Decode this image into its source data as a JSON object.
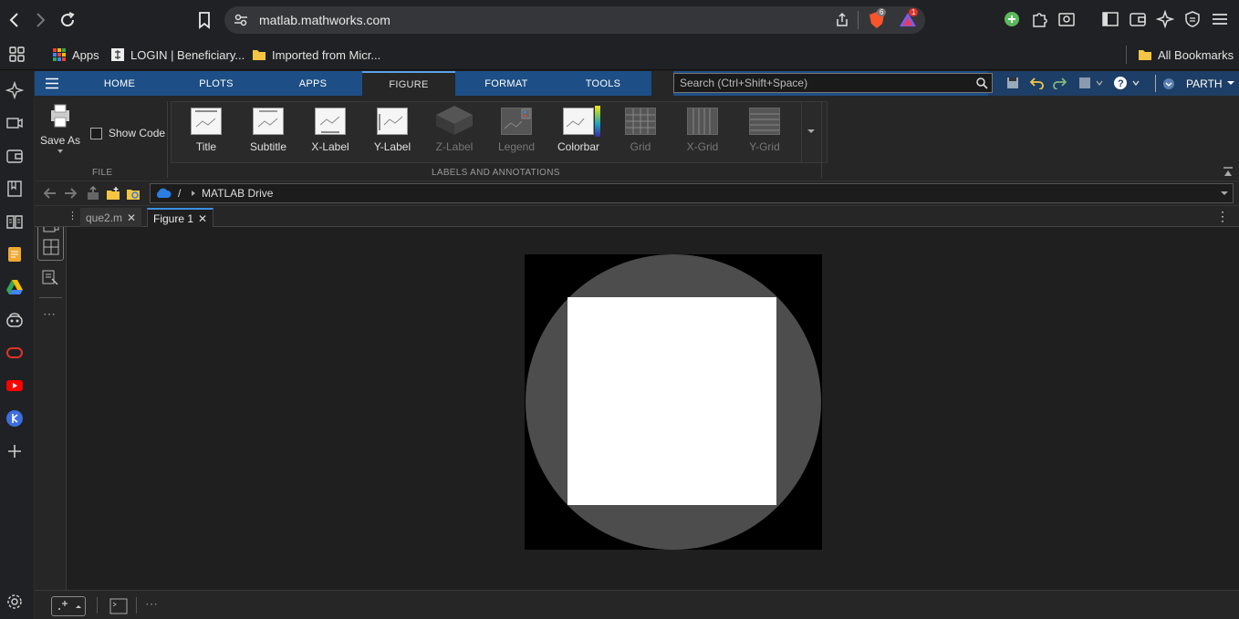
{
  "browser": {
    "url": "matlab.mathworks.com",
    "brave_badge": "6",
    "rewards_badge": "1"
  },
  "bookmarks": {
    "items": [
      "Apps",
      "LOGIN | Beneficiary...",
      "Imported from Micr..."
    ],
    "right": "All Bookmarks"
  },
  "matlab": {
    "tabs": [
      "HOME",
      "PLOTS",
      "APPS",
      "FIGURE",
      "FORMAT",
      "TOOLS"
    ],
    "active_tab": "FIGURE",
    "search_placeholder": "Search (Ctrl+Shift+Space)",
    "user": "PARTH",
    "help": "?"
  },
  "toolstrip": {
    "file": {
      "save_as": "Save As",
      "show_code": "Show Code",
      "section": "FILE"
    },
    "labels": {
      "section": "LABELS AND ANNOTATIONS",
      "items": [
        {
          "label": "Title",
          "enabled": true
        },
        {
          "label": "Subtitle",
          "enabled": true
        },
        {
          "label": "X-Label",
          "enabled": true
        },
        {
          "label": "Y-Label",
          "enabled": true
        },
        {
          "label": "Z-Label",
          "enabled": false
        },
        {
          "label": "Legend",
          "enabled": false
        },
        {
          "label": "Colorbar",
          "enabled": true
        },
        {
          "label": "Grid",
          "enabled": false
        },
        {
          "label": "X-Grid",
          "enabled": false
        },
        {
          "label": "Y-Grid",
          "enabled": false
        }
      ]
    }
  },
  "address": {
    "root": "/",
    "folder": "MATLAB Drive"
  },
  "editor_tabs": [
    {
      "label": "que2.m",
      "active": false
    },
    {
      "label": "Figure 1",
      "active": true
    }
  ],
  "figure": {
    "background": "#000000",
    "circle_color": "#4d4d4d",
    "square_color": "#ffffff"
  },
  "colors": {
    "ribbon_blue": "#1d4f86",
    "active_tab_border": "#5ea0e8"
  }
}
